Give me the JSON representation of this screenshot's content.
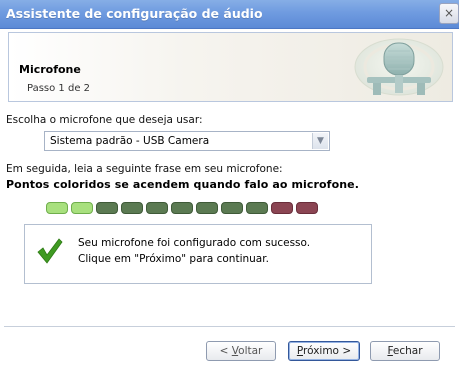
{
  "window": {
    "title": "Assistente de configuração de áudio",
    "close_label": "×"
  },
  "header": {
    "title": "Microfone",
    "step": "Passo 1 de 2",
    "emblem_icon": "microphone-icon"
  },
  "body": {
    "choose_label": "Escolha o microfone que deseja usar:",
    "microphone_select": {
      "selected": "Sistema padrão - USB Camera"
    },
    "instruction": "Em seguida, leia a seguinte frase em seu microfone:",
    "phrase": "Pontos coloridos se acendem quando falo ao microfone.",
    "level_meter": {
      "lit_count": 2,
      "total": 11,
      "colors": {
        "lit": "#a8e07e",
        "green": "#5b7a52",
        "red": "#8b4553"
      }
    },
    "success": {
      "icon": "checkmark-icon",
      "line1": "Seu microfone foi configurado com sucesso.",
      "line2": "Clique em \"Próximo\" para continuar."
    }
  },
  "buttons": {
    "back": {
      "prefix": "< ",
      "mnemonic": "V",
      "rest": "oltar"
    },
    "next": {
      "mnemonic": "P",
      "rest": "róximo >"
    },
    "close": {
      "mnemonic": "F",
      "rest": "echar"
    }
  },
  "colors": {
    "titlebar": "#6f9be0",
    "checkmark": "#3f9a22"
  }
}
